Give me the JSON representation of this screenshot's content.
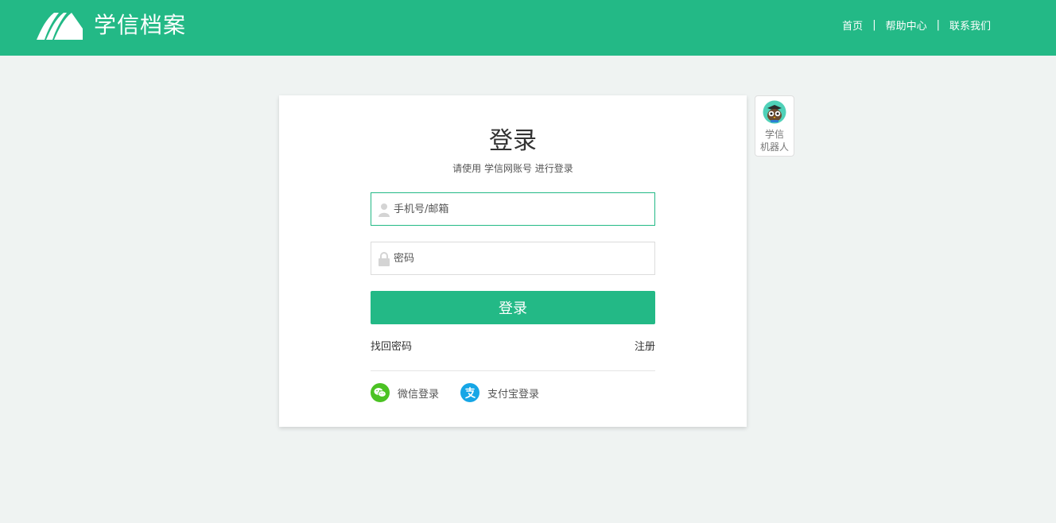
{
  "header": {
    "logo_text": "学信档案",
    "nav": [
      {
        "label": "首页"
      },
      {
        "label": "帮助中心"
      },
      {
        "label": "联系我们"
      }
    ],
    "separator": "|",
    "brand_color": "#23b986"
  },
  "login": {
    "title": "登录",
    "subtitle": "请使用 学信网账号 进行登录",
    "username_placeholder": "手机号/邮箱",
    "password_placeholder": "密码",
    "submit_label": "登录",
    "forgot_label": "找回密码",
    "register_label": "注册",
    "social": [
      {
        "label": "微信登录",
        "icon": "wechat-icon",
        "color": "#4bc223"
      },
      {
        "label": "支付宝登录",
        "icon": "alipay-icon",
        "color": "#16a6e6"
      }
    ]
  },
  "robot": {
    "line1": "学信",
    "line2": "机器人"
  }
}
